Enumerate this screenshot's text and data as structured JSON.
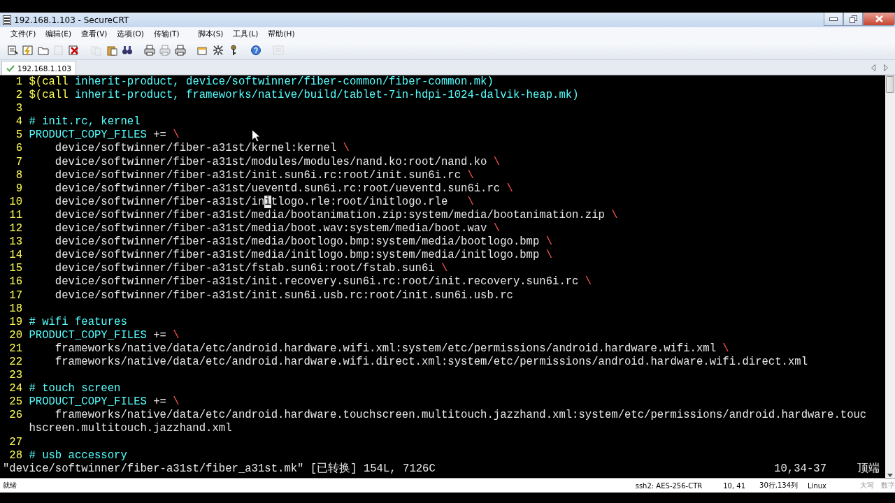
{
  "window": {
    "title": "192.168.1.103 - SecureCRT"
  },
  "menu": [
    "文件(F)",
    "编辑(E)",
    "查看(V)",
    "选项(O)",
    "传输(T)",
    "脚本(S)",
    "工具(L)",
    "帮助(H)"
  ],
  "toolbar": [
    {
      "kind": "connect",
      "disabled": false
    },
    {
      "kind": "quick",
      "disabled": false
    },
    {
      "kind": "tab",
      "disabled": false
    },
    {
      "kind": "reconnect",
      "disabled": true
    },
    {
      "kind": "disconnect",
      "disabled": false
    },
    {
      "kind": "copy",
      "disabled": true
    },
    {
      "kind": "paste",
      "disabled": false
    },
    {
      "kind": "find",
      "disabled": false
    },
    {
      "kind": "print",
      "disabled": false
    },
    {
      "kind": "print",
      "disabled": true
    },
    {
      "kind": "print",
      "disabled": false
    },
    {
      "kind": "options",
      "disabled": false
    },
    {
      "kind": "global",
      "disabled": false
    },
    {
      "kind": "key",
      "disabled": false
    },
    {
      "kind": "help",
      "disabled": false
    },
    {
      "kind": "map",
      "disabled": true
    }
  ],
  "tabs": [
    {
      "label": "192.168.1.103",
      "connected": true,
      "selected": true
    }
  ],
  "terminal": {
    "lines": [
      {
        "number": "1",
        "segments": [
          {
            "kind": "call",
            "text": "$(call"
          },
          {
            "kind": "ident",
            "text": " inherit-product, device/softwinner/fiber-common/fiber-common.mk)"
          }
        ]
      },
      {
        "number": "2",
        "segments": [
          {
            "kind": "call",
            "text": "$(call"
          },
          {
            "kind": "ident",
            "text": " inherit-product, frameworks/native/build/tablet-7in-hdpi-1024-dalvik-heap.mk)"
          }
        ]
      },
      {
        "number": "3"
      },
      {
        "number": "4",
        "segments": [
          {
            "kind": "ident",
            "text": "# init.rc, kernel"
          }
        ]
      },
      {
        "number": "5",
        "segments": [
          {
            "kind": "ident",
            "text": "PRODUCT_COPY_FILES"
          },
          {
            "kind": "plain",
            "text": " += "
          },
          {
            "kind": "cont",
            "text": "\\"
          }
        ]
      },
      {
        "number": "6",
        "segments": [
          {
            "kind": "plain",
            "text": "    device/softwinner/fiber-a31st/kernel:kernel "
          },
          {
            "kind": "cont",
            "text": "\\"
          }
        ]
      },
      {
        "number": "7",
        "segments": [
          {
            "kind": "plain",
            "text": "    device/softwinner/fiber-a31st/modules/modules/nand.ko:root/nand.ko "
          },
          {
            "kind": "cont",
            "text": "\\"
          }
        ]
      },
      {
        "number": "8",
        "segments": [
          {
            "kind": "plain",
            "text": "    device/softwinner/fiber-a31st/init.sun6i.rc:root/init.sun6i.rc "
          },
          {
            "kind": "cont",
            "text": "\\"
          }
        ]
      },
      {
        "number": "9",
        "segments": [
          {
            "kind": "plain",
            "text": "    device/softwinner/fiber-a31st/ueventd.sun6i.rc:root/ueventd.sun6i.rc "
          },
          {
            "kind": "cont",
            "text": "\\"
          }
        ]
      },
      {
        "number": "10",
        "segments": [
          {
            "kind": "plain",
            "text": "    device/softwinner/fiber-a31st/in"
          },
          {
            "kind": "cursor",
            "text": "i"
          },
          {
            "kind": "plain",
            "text": "tlogo.rle:root/initlogo.rle   "
          },
          {
            "kind": "cont",
            "text": "\\"
          }
        ]
      },
      {
        "number": "11",
        "segments": [
          {
            "kind": "plain",
            "text": "    device/softwinner/fiber-a31st/media/bootanimation.zip:system/media/bootanimation.zip "
          },
          {
            "kind": "cont",
            "text": "\\"
          }
        ]
      },
      {
        "number": "12",
        "segments": [
          {
            "kind": "plain",
            "text": "    device/softwinner/fiber-a31st/media/boot.wav:system/media/boot.wav "
          },
          {
            "kind": "cont",
            "text": "\\"
          }
        ]
      },
      {
        "number": "13",
        "segments": [
          {
            "kind": "plain",
            "text": "    device/softwinner/fiber-a31st/media/bootlogo.bmp:system/media/bootlogo.bmp "
          },
          {
            "kind": "cont",
            "text": "\\"
          }
        ]
      },
      {
        "number": "14",
        "segments": [
          {
            "kind": "plain",
            "text": "    device/softwinner/fiber-a31st/media/initlogo.bmp:system/media/initlogo.bmp "
          },
          {
            "kind": "cont",
            "text": "\\"
          }
        ]
      },
      {
        "number": "15",
        "segments": [
          {
            "kind": "plain",
            "text": "    device/softwinner/fiber-a31st/fstab.sun6i:root/fstab.sun6i "
          },
          {
            "kind": "cont",
            "text": "\\"
          }
        ]
      },
      {
        "number": "16",
        "segments": [
          {
            "kind": "plain",
            "text": "    device/softwinner/fiber-a31st/init.recovery.sun6i.rc:root/init.recovery.sun6i.rc "
          },
          {
            "kind": "cont",
            "text": "\\"
          }
        ]
      },
      {
        "number": "17",
        "segments": [
          {
            "kind": "plain",
            "text": "    device/softwinner/fiber-a31st/init.sun6i.usb.rc:root/init.sun6i.usb.rc"
          }
        ]
      },
      {
        "number": "18"
      },
      {
        "number": "19",
        "segments": [
          {
            "kind": "ident",
            "text": "# wifi features"
          }
        ]
      },
      {
        "number": "20",
        "segments": [
          {
            "kind": "ident",
            "text": "PRODUCT_COPY_FILES"
          },
          {
            "kind": "plain",
            "text": " += "
          },
          {
            "kind": "cont",
            "text": "\\"
          }
        ]
      },
      {
        "number": "21",
        "segments": [
          {
            "kind": "plain",
            "text": "    frameworks/native/data/etc/android.hardware.wifi.xml:system/etc/permissions/android.hardware.wifi.xml "
          },
          {
            "kind": "cont",
            "text": "\\"
          }
        ]
      },
      {
        "number": "22",
        "segments": [
          {
            "kind": "plain",
            "text": "    frameworks/native/data/etc/android.hardware.wifi.direct.xml:system/etc/permissions/android.hardware.wifi.direct.xml"
          }
        ]
      },
      {
        "number": "23"
      },
      {
        "number": "24",
        "segments": [
          {
            "kind": "ident",
            "text": "# touch screen"
          }
        ]
      },
      {
        "number": "25",
        "segments": [
          {
            "kind": "ident",
            "text": "PRODUCT_COPY_FILES"
          },
          {
            "kind": "plain",
            "text": " += "
          },
          {
            "kind": "cont",
            "text": "\\"
          }
        ]
      },
      {
        "number": "26",
        "segments": [
          {
            "kind": "plain",
            "text": "    frameworks/native/data/etc/android.hardware.touchscreen.multitouch.jazzhand.xml:system/etc/permissions/android.hardware.touchscreen.multitouch.jazzhand.xml"
          }
        ]
      },
      {
        "number": "27"
      },
      {
        "number": "28",
        "segments": [
          {
            "kind": "ident",
            "text": "# usb accessory"
          }
        ]
      }
    ],
    "message": "\"device/softwinner/fiber-a31st/fiber_a31st.mk\" [已转换] 154L, 7126C",
    "position": "10,34-37",
    "scroll": "顶端"
  },
  "status_bar": [
    {
      "kind": "ready",
      "text": "就绪",
      "enabled": true
    },
    {
      "kind": "cipher",
      "text": "ssh2: AES-256-CTR",
      "enabled": true
    },
    {
      "kind": "cursor",
      "text": "10,  41",
      "enabled": true
    },
    {
      "kind": "size",
      "text": "30行,134列",
      "enabled": true
    },
    {
      "kind": "term",
      "text": "Linux",
      "enabled": true
    },
    {
      "kind": "caps",
      "text": "大写",
      "enabled": false
    },
    {
      "kind": "num",
      "text": "数字",
      "enabled": false
    }
  ]
}
